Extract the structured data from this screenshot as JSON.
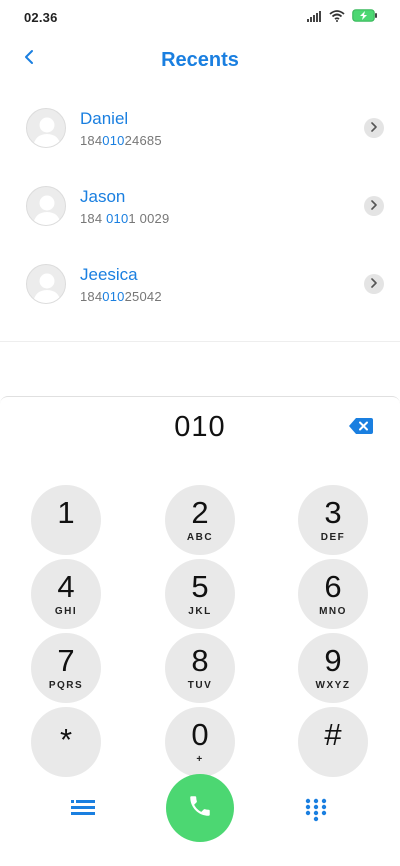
{
  "status_bar": {
    "time": "02.36",
    "icons": [
      "signal-icon",
      "wifi-icon",
      "battery-charging-icon"
    ],
    "battery_color": "#4cd772"
  },
  "header": {
    "title": "Recents",
    "back_icon": "chevron-left-icon"
  },
  "contacts": [
    {
      "name": "Daniel",
      "number_pre": "184",
      "number_match": "010",
      "number_post": "24685"
    },
    {
      "name": "Jason",
      "number_pre": "184 ",
      "number_match": "010",
      "number_post": "1 0029"
    },
    {
      "name": "Jeesica",
      "number_pre": "184",
      "number_match": "010",
      "number_post": "25042"
    }
  ],
  "dialer": {
    "input_value": "010",
    "keys": [
      {
        "digit": "1",
        "letters": ""
      },
      {
        "digit": "2",
        "letters": "ABC"
      },
      {
        "digit": "3",
        "letters": "DEF"
      },
      {
        "digit": "4",
        "letters": "GHI"
      },
      {
        "digit": "5",
        "letters": "JKL"
      },
      {
        "digit": "6",
        "letters": "MNO"
      },
      {
        "digit": "7",
        "letters": "PQRS"
      },
      {
        "digit": "8",
        "letters": "TUV"
      },
      {
        "digit": "9",
        "letters": "WXYZ"
      },
      {
        "digit": "*",
        "letters": ""
      },
      {
        "digit": "0",
        "letters": "+"
      },
      {
        "digit": "#",
        "letters": ""
      }
    ],
    "bottom_icons": [
      "menu-icon",
      "phone-icon",
      "keypad-icon"
    ]
  },
  "colors": {
    "accent": "#1a7fe0",
    "call": "#4cd772",
    "key_bg": "#e9e9e9"
  }
}
